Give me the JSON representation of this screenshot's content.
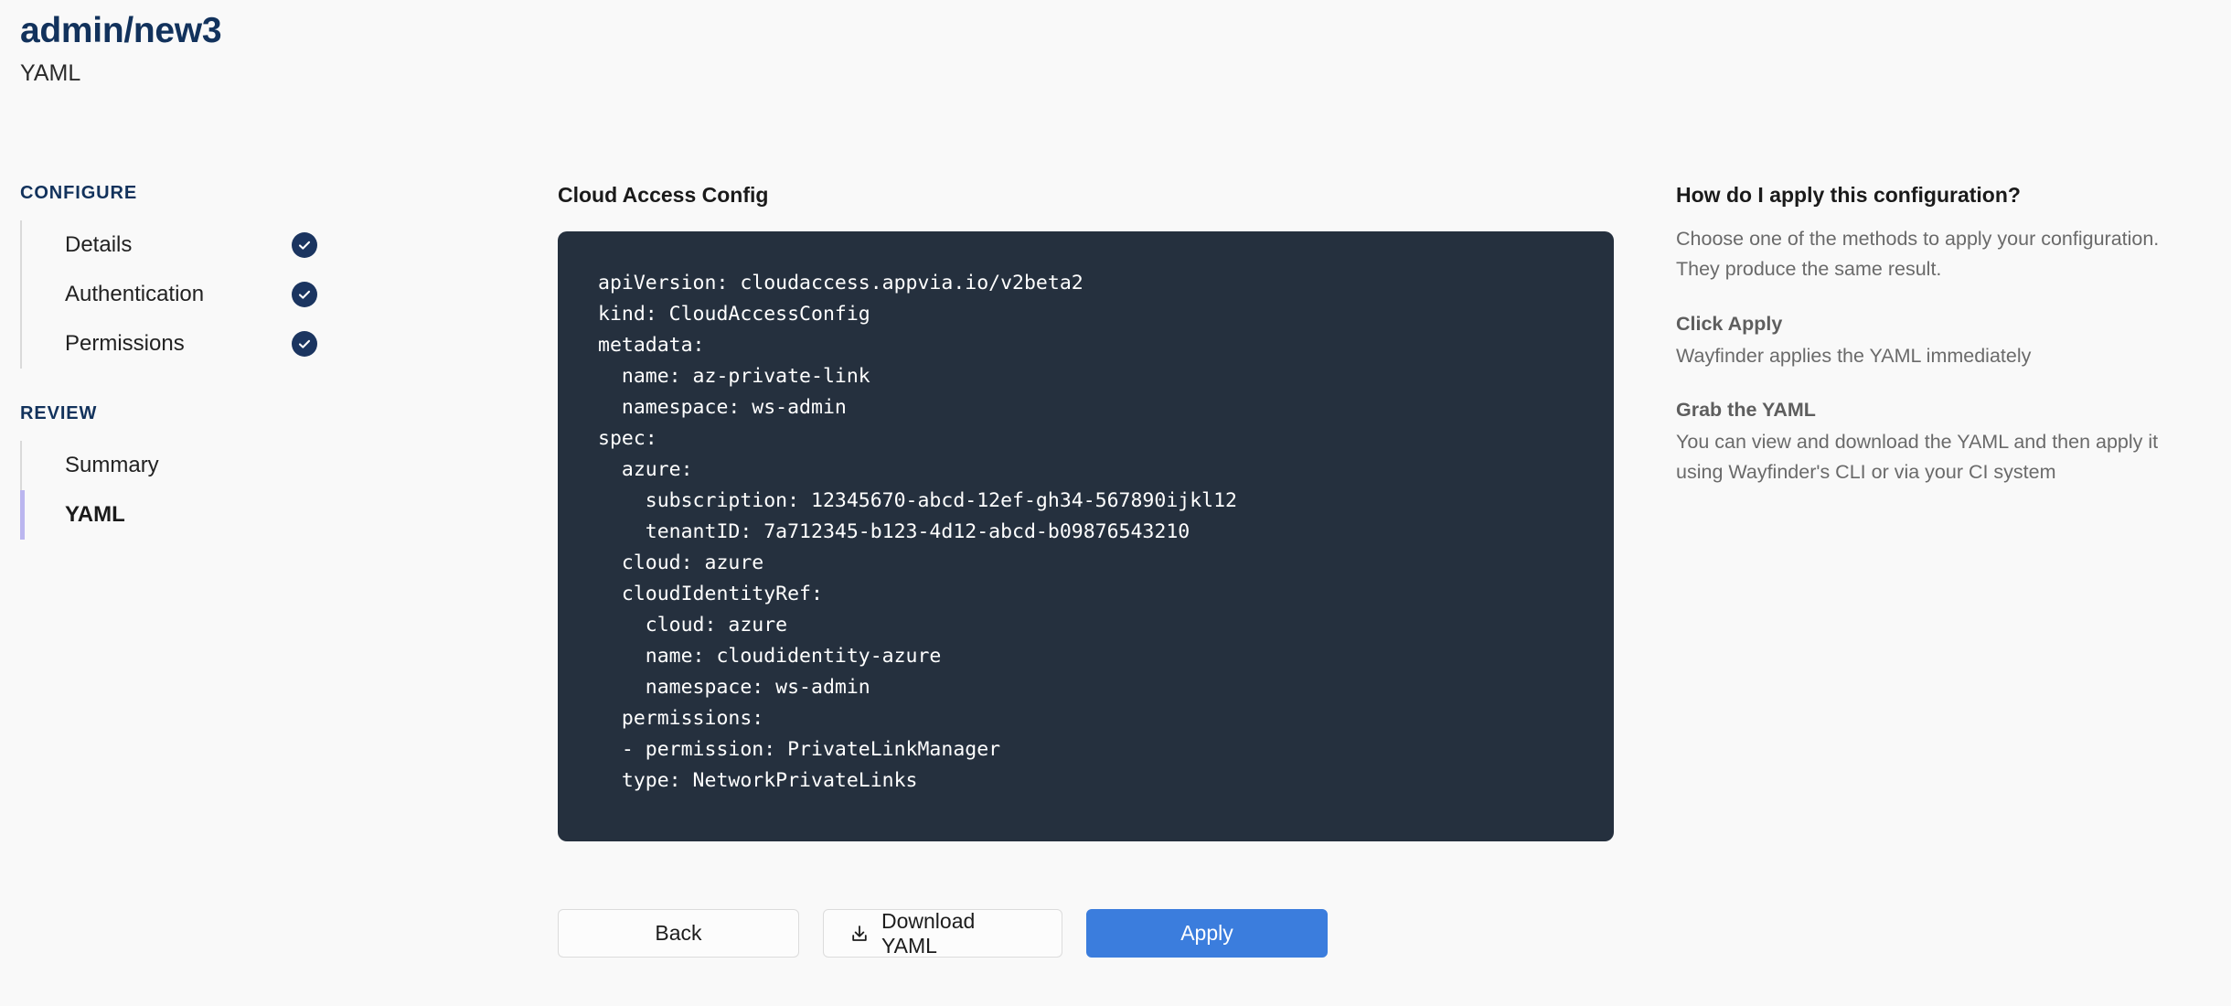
{
  "header": {
    "title": "admin/new3",
    "subtitle": "YAML"
  },
  "sidebar": {
    "sections": [
      {
        "title": "CONFIGURE",
        "items": [
          {
            "label": "Details",
            "completed": true,
            "active": false
          },
          {
            "label": "Authentication",
            "completed": true,
            "active": false
          },
          {
            "label": "Permissions",
            "completed": true,
            "active": false
          }
        ]
      },
      {
        "title": "REVIEW",
        "items": [
          {
            "label": "Summary",
            "completed": false,
            "active": false
          },
          {
            "label": "YAML",
            "completed": false,
            "active": true
          }
        ]
      }
    ]
  },
  "main": {
    "heading": "Cloud Access Config",
    "yaml": "apiVersion: cloudaccess.appvia.io/v2beta2\nkind: CloudAccessConfig\nmetadata:\n  name: az-private-link\n  namespace: ws-admin\nspec:\n  azure:\n    subscription: 12345670-abcd-12ef-gh34-567890ijkl12\n    tenantID: 7a712345-b123-4d12-abcd-b09876543210\n  cloud: azure\n  cloudIdentityRef:\n    cloud: azure\n    name: cloudidentity-azure\n    namespace: ws-admin\n  permissions:\n  - permission: PrivateLinkManager\n  type: NetworkPrivateLinks",
    "buttons": {
      "back": "Back",
      "download": "Download YAML",
      "apply": "Apply"
    }
  },
  "aside": {
    "title": "How do I apply this configuration?",
    "intro": "Choose one of the methods to apply your configuration. They produce the same result.",
    "methods": [
      {
        "title": "Click Apply",
        "description": "Wayfinder applies the YAML immediately"
      },
      {
        "title": "Grab the YAML",
        "description": "You can view and download the YAML and then apply it using Wayfinder's CLI or via your CI system"
      }
    ]
  },
  "colors": {
    "accent_navy": "#12325c",
    "primary_blue": "#3b7ddd",
    "active_indicator": "#bbb6ef",
    "code_background": "#25303e",
    "page_background": "#f9f9f9"
  }
}
